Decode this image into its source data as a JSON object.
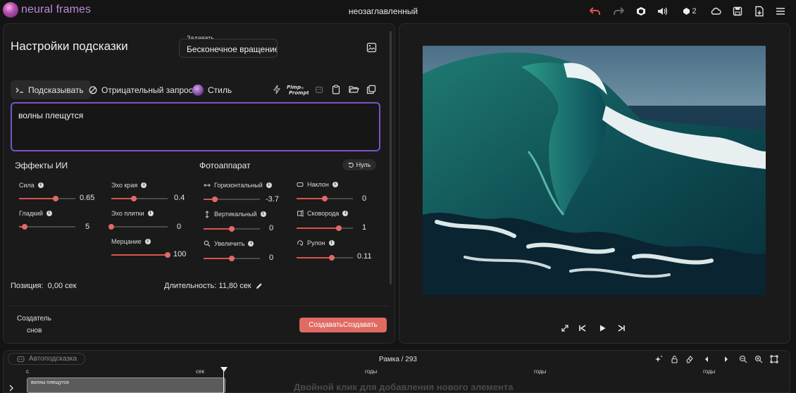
{
  "app": {
    "brand": "neural frames",
    "doc_title": "неозаглавленный",
    "credits_badge": "2"
  },
  "toolbar_icons": [
    "undo-icon",
    "redo-icon",
    "cube-icon",
    "volume-icon",
    "credits-icon",
    "cloud-icon",
    "save-icon",
    "export-icon",
    "menu-icon"
  ],
  "colors": {
    "accent": "#7a52c9",
    "brand": "#b98ad8",
    "slider": "#d9534f",
    "generate": "#e06b63",
    "undo": "#e0524a"
  },
  "prompt_settings": {
    "title": "Настройки подсказки",
    "set_label": "Задавать",
    "set_value": "Бесконечное вращение*ф",
    "tabs": {
      "prompt": "Подсказывать",
      "negative": "Отрицательный запрос",
      "style": "Стиль"
    },
    "prompt_text": "волны плещутся",
    "pimp_label": "Pimp my Prompt"
  },
  "ai_effects": {
    "title": "Эффекты ИИ",
    "sliders": {
      "strength": {
        "label": "Сила",
        "display": "0.65",
        "fraction": 0.65
      },
      "edge_echo": {
        "label": "Эхо края",
        "display": "0.4",
        "fraction": 0.4
      },
      "smooth": {
        "label": "Гладкий",
        "display": "5",
        "fraction": 0.1
      },
      "tile_echo": {
        "label": "Эхо плитки",
        "display": "0",
        "fraction": 0.0
      },
      "flicker": {
        "label": "Мерцание",
        "display": "100",
        "fraction": 1.0
      }
    }
  },
  "camera": {
    "title": "Фотоаппарат",
    "reset_label": "Нуль",
    "sliders": {
      "horizontal": {
        "label": "Горизонтальный",
        "display": "-3.7",
        "fraction": 0.2
      },
      "tilt": {
        "label": "Наклон",
        "display": "0",
        "fraction": 0.5
      },
      "vertical": {
        "label": "Вертикальный",
        "display": "0",
        "fraction": 0.5
      },
      "pan": {
        "label": "Сковорода",
        "display": "1",
        "fraction": 0.75
      },
      "zoom": {
        "label": "Увеличить",
        "display": "0",
        "fraction": 0.5
      },
      "roll": {
        "label": "Рулон",
        "display": "0.11",
        "fraction": 0.62
      }
    }
  },
  "footer": {
    "position_label": "Позиция:",
    "position_value": "0,00 сек",
    "duration_label": "Длительность:",
    "duration_value": "11,80 сек",
    "creator_label": "Создатель",
    "creator_value": "снов",
    "generate_label": "СоздаватьСоздавать"
  },
  "timeline": {
    "autoprompt_label": "Автоподсказка",
    "frame_label": "Рамка / 293",
    "ruler": [
      "с",
      "сек",
      "годы",
      "годы",
      "годы"
    ],
    "clip_text": "волны плещутся",
    "hint": "Двойной клик для добавления нового элемента"
  }
}
